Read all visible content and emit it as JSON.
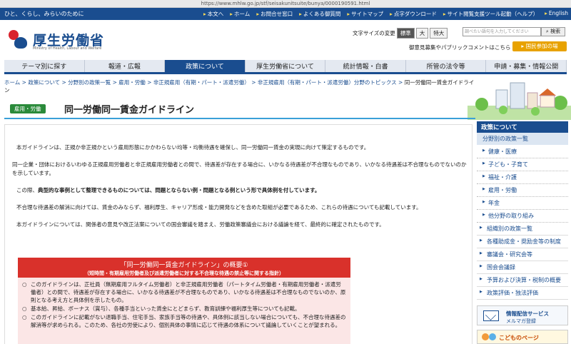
{
  "browser": {
    "url": "https://www.mhlw.go.jp/stf/seisakunitsuite/bunya/0000190591.html"
  },
  "utility": {
    "tagline": "ひと、くらし、みらいのために",
    "links": [
      "本文へ",
      "ホーム",
      "お問合せ窓口",
      "よくある御質問",
      "サイトマップ",
      "点字ダウンロード",
      "サイト閲覧支援ツール起動（ヘルプ）",
      "English"
    ]
  },
  "header": {
    "logo_text": "厚生労働省",
    "logo_sub": "Ministry of Health, Labour and Welfare",
    "font_size_label": "文字サイズの変更",
    "font_sizes": [
      "標準",
      "大",
      "特大"
    ],
    "search_placeholder": "調べたい語句を入力してください",
    "search_button": "検索",
    "public_comment_link": "御意見募集やパブリックコメントはこちら",
    "kokumin_button": "国民参加の場"
  },
  "nav": [
    "テーマ別に探す",
    "報道・広報",
    "政策について",
    "厚生労働省について",
    "統計情報・白書",
    "所管の法令等",
    "申請・募集・情報公開"
  ],
  "breadcrumb": {
    "links": [
      "ホーム",
      "政策について",
      "分野別の政策一覧",
      "雇用・労働",
      "非正規雇用（有期・パート・派遣労働）",
      "非正規雇用（有期・パート・派遣労働）分野のトピックス"
    ],
    "current": "同一労働同一賃金ガイドライン"
  },
  "page": {
    "category": "雇用・労働",
    "title": "同一労働同一賃金ガイドライン"
  },
  "content": {
    "p1": "本ガイドラインは、正規か非正規かという雇用形態にかかわらない均等・均衡待遇を確保し、同一労働同一賃金の実現に向けて策定するものです。",
    "p2": "同一企業・団体におけるいわゆる正規雇用労働者と非正規雇用労働者との間で、待遇差が存在する場合に、いかなる待遇差が不合理なものであり、いかなる待遇差は不合理なものでないのかを示しています。",
    "p3_prefix": "この際、",
    "p3_bold": "典型的な事例として整理できるものについては、問題とならない例・問題となる例という形で具体例を付しています。",
    "p4": "不合理な待遇差の解消に向けては、賃金のみならず、福利厚生、キャリア形成・能力開発などを含めた取組が必要であるため、これらの待遇についても記載しています。",
    "p5": "本ガイドラインについては、関係者の意見や改正法案についての国会審議を踏まえ、労働政策審議会における議論を経て、最終的に確定されたものです。"
  },
  "summary": {
    "title": "「同一労働同一賃金ガイドライン」の概要①",
    "subtitle": "（短時間・有期雇用労働者及び派遣労働者に対する不合理な待遇の禁止等に関する指針）",
    "bullets": [
      "このガイドラインは、正社員（無期雇用フルタイム労働者）と非正規雇用労働者（パートタイム労働者・有期雇用労働者・派遣労働者）との間で、待遇差が存在する場合に、いかなる待遇差が不合理なものであり、いかなる待遇差は不合理なものでないのか、原則となる考え方と具体例を示したもの。",
      "基本給、昇給、ボーナス（賞与）、各種手当といった賃金にとどまらず、教育訓練や福利厚生等についても記載。",
      "このガイドラインに記載がない退職手当、住宅手当、家族手当等の待遇や、具体例に該当しない場合についても、不合理な待遇差の解消等が求められる。このため、各社の労使により、個別具体の事情に応じて待遇の体系について議論していくことが望まれる。"
    ]
  },
  "sidebar": {
    "head": "政策について",
    "sub": "分野別の政策一覧",
    "children": [
      "健康・医療",
      "子ども・子育て",
      "福祉・介護",
      "雇用・労働",
      "年金",
      "他分野の取り組み"
    ],
    "items": [
      "組織別の政策一覧",
      "各種助成金・奨励金等の制度",
      "審議会・研究会等",
      "国会会議録",
      "予算および決算・税制の概要",
      "政策評価・独法評価"
    ],
    "mail_title": "情報配信サービス",
    "mail_sub": "メルマガ登録",
    "kids": "こどものページ"
  },
  "colors": {
    "brand": "#1a4d8f",
    "accent_red": "#d9312b",
    "category_green": "#2a8a3a",
    "button_orange": "#e8a200"
  }
}
